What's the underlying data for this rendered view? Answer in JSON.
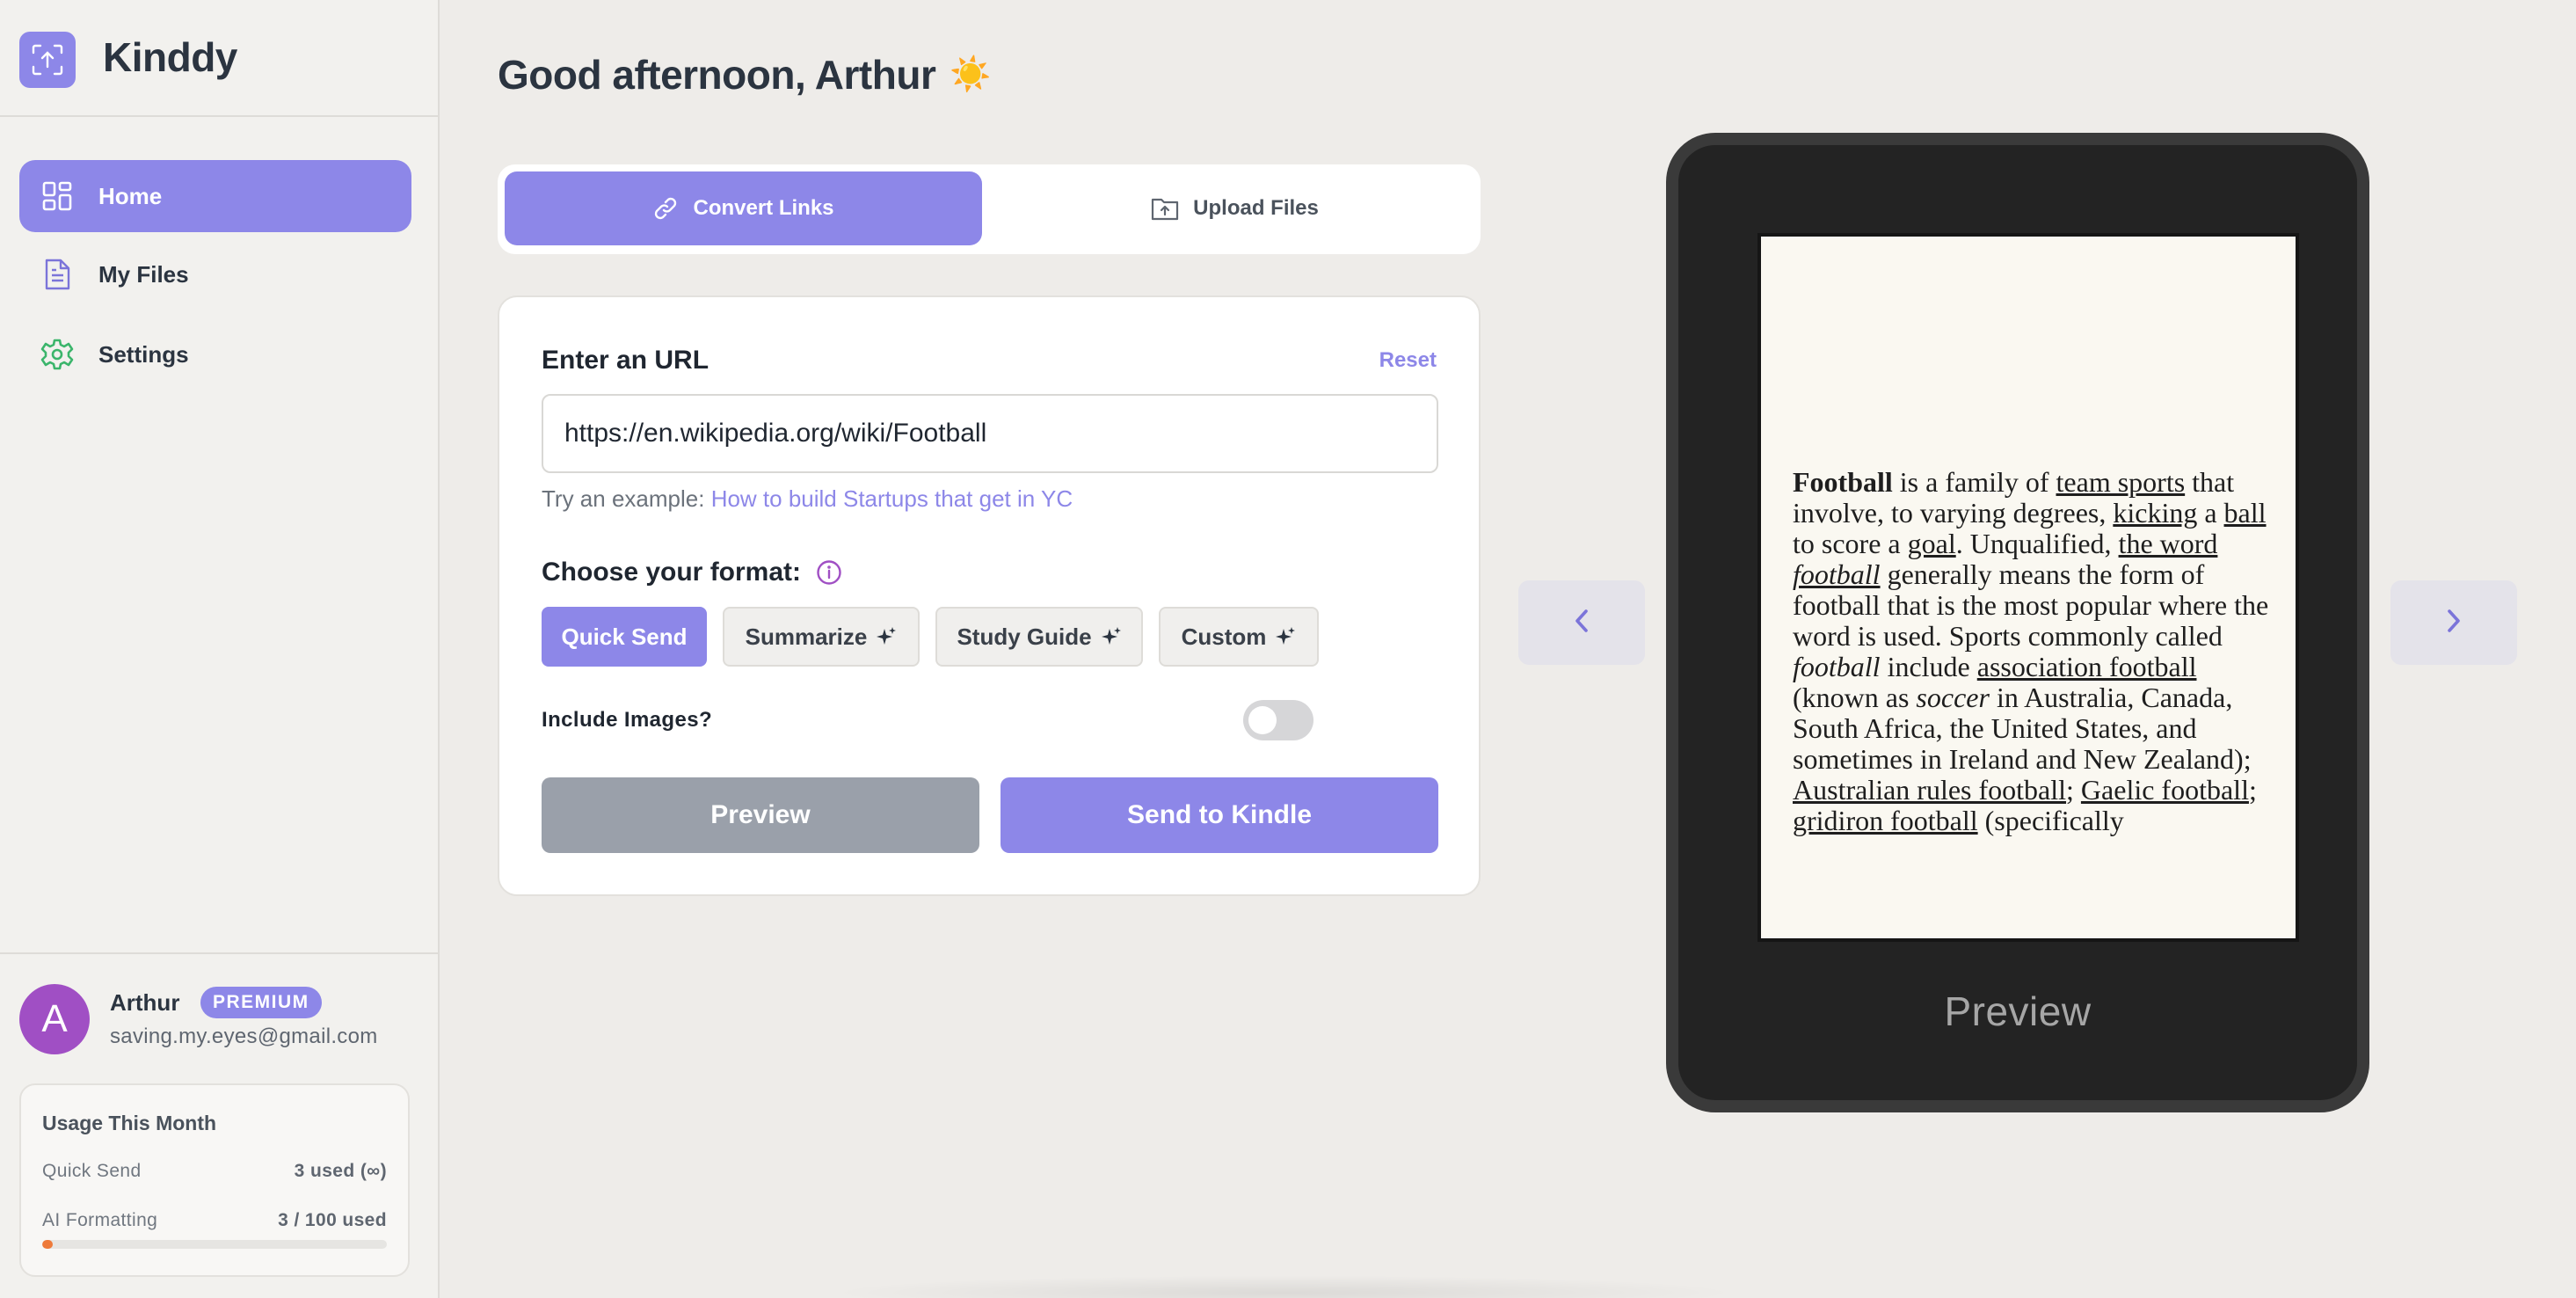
{
  "app": {
    "name": "Kinddy",
    "logo_icon": "upload-frame-icon"
  },
  "sidebar": {
    "items": [
      {
        "label": "Home",
        "icon": "dashboard-grid-icon",
        "active": true
      },
      {
        "label": "My Files",
        "icon": "document-icon",
        "active": false
      },
      {
        "label": "Settings",
        "icon": "gear-icon",
        "active": false
      }
    ]
  },
  "user": {
    "initial": "A",
    "name": "Arthur",
    "badge": "PREMIUM",
    "email": "saving.my.eyes@gmail.com"
  },
  "usage": {
    "title": "Usage This Month",
    "rows": [
      {
        "label": "Quick Send",
        "value": "3 used (∞)"
      },
      {
        "label": "AI Formatting",
        "value": "3 / 100 used"
      }
    ],
    "ai_formatting_fraction": 0.03
  },
  "main": {
    "greeting": "Good afternoon, Arthur",
    "greeting_emoji": "☀️",
    "tabs": [
      {
        "label": "Convert Links",
        "icon": "link-icon",
        "active": true
      },
      {
        "label": "Upload Files",
        "icon": "folder-upload-icon",
        "active": false
      }
    ],
    "form": {
      "url_label": "Enter an URL",
      "reset_label": "Reset",
      "url_value": "https://en.wikipedia.org/wiki/Football",
      "example_prefix": "Try an example:",
      "example_link": "How to build Startups that get in YC",
      "format_label": "Choose your format:",
      "formats": [
        {
          "label": "Quick Send",
          "active": true,
          "ai": false
        },
        {
          "label": "Summarize",
          "active": false,
          "ai": true
        },
        {
          "label": "Study Guide",
          "active": false,
          "ai": true
        },
        {
          "label": "Custom",
          "active": false,
          "ai": true
        }
      ],
      "include_images_label": "Include Images?",
      "include_images": false,
      "preview_button": "Preview",
      "send_button": "Send to Kindle"
    }
  },
  "preview": {
    "caption": "Preview",
    "segments": [
      {
        "t": "Football",
        "b": true
      },
      {
        "t": " is a family of "
      },
      {
        "t": "team sports",
        "u": true
      },
      {
        "t": " that involve, to varying degrees, "
      },
      {
        "t": "kicking",
        "u": true
      },
      {
        "t": " a "
      },
      {
        "t": "ball",
        "u": true
      },
      {
        "t": " to score a "
      },
      {
        "t": "goal",
        "u": true
      },
      {
        "t": ". Unqualified, "
      },
      {
        "t": "the word ",
        "u": true
      },
      {
        "t": "football",
        "u": true,
        "i": true
      },
      {
        "t": " generally means the form of football that is the most popular where the word is used. Sports commonly called "
      },
      {
        "t": "football",
        "i": true
      },
      {
        "t": " include "
      },
      {
        "t": "association football",
        "u": true
      },
      {
        "t": " (known as "
      },
      {
        "t": "soccer",
        "i": true
      },
      {
        "t": " in Australia, Canada, South Africa, the United States, and sometimes in Ireland and New Zealand); "
      },
      {
        "t": "Australian rules football",
        "u": true
      },
      {
        "t": "; "
      },
      {
        "t": "Gaelic football",
        "u": true
      },
      {
        "t": "; "
      },
      {
        "t": "gridiron football",
        "u": true
      },
      {
        "t": " (specifically"
      }
    ]
  },
  "colors": {
    "accent": "#8d87e8",
    "progress": "#ee7a3a",
    "avatar": "#a04fc4"
  }
}
